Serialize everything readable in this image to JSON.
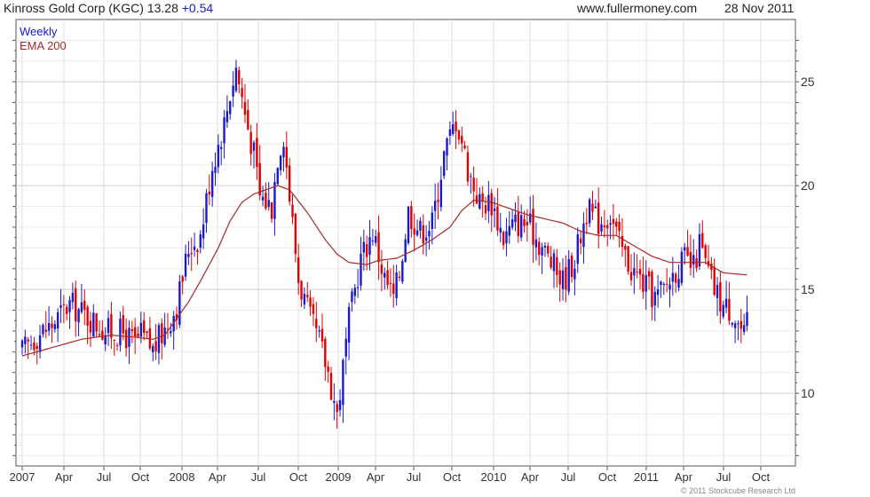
{
  "header": {
    "ticker_text": "Kinross Gold Corp (KGC) 13.28",
    "change": "+0.54",
    "website": "www.fullermoney.com",
    "date": "28 Nov 2011"
  },
  "legend": {
    "period": "Weekly",
    "indicator": "EMA 200"
  },
  "copyright": "© 2011 Stockcube Research Ltd",
  "colors": {
    "up": "#1a1acd",
    "down": "#e00000",
    "ema": "#a52a2a",
    "grid": "#dcdcdc",
    "axis": "#555555"
  },
  "chart_data": {
    "type": "candlestick",
    "title": "Kinross Gold Corp (KGC) 13.28 +0.54",
    "period": "Weekly",
    "indicator": "EMA 200",
    "x_ticks": [
      "2007",
      "Apr",
      "Jul",
      "Oct",
      "2008",
      "Apr",
      "Jul",
      "Oct",
      "2009",
      "Apr",
      "Jul",
      "Oct",
      "2010",
      "Apr",
      "Jul",
      "Oct",
      "2011",
      "Apr",
      "Jul",
      "Oct"
    ],
    "y_ticks": [
      10,
      15,
      20,
      25
    ],
    "ylim": [
      6.5,
      28
    ],
    "x_range_weeks": [
      0,
      257
    ],
    "grid": true,
    "price_path": [
      [
        0,
        12.0
      ],
      [
        5,
        12.8
      ],
      [
        10,
        13.3
      ],
      [
        16,
        14.3
      ],
      [
        22,
        13.7
      ],
      [
        28,
        13.0
      ],
      [
        34,
        12.9
      ],
      [
        38,
        12.4
      ],
      [
        40,
        12.8
      ],
      [
        44,
        12.1
      ],
      [
        48,
        13.1
      ],
      [
        52,
        14.2
      ],
      [
        56,
        17.0
      ],
      [
        60,
        17.6
      ],
      [
        64,
        21.0
      ],
      [
        68,
        23.0
      ],
      [
        70,
        24.5
      ],
      [
        72,
        25.7
      ],
      [
        75,
        23.5
      ],
      [
        78,
        21.5
      ],
      [
        80,
        19.5
      ],
      [
        84,
        19.0
      ],
      [
        86,
        21.5
      ],
      [
        88,
        22.5
      ],
      [
        90,
        19.5
      ],
      [
        93,
        15.5
      ],
      [
        97,
        13.5
      ],
      [
        100,
        12.5
      ],
      [
        103,
        11.0
      ],
      [
        106,
        9.0
      ],
      [
        108,
        11.2
      ],
      [
        110,
        13.5
      ],
      [
        114,
        16.5
      ],
      [
        118,
        17.8
      ],
      [
        122,
        15.5
      ],
      [
        125,
        14.6
      ],
      [
        127,
        15.8
      ],
      [
        130,
        18.8
      ],
      [
        134,
        17.8
      ],
      [
        138,
        18.2
      ],
      [
        142,
        21.5
      ],
      [
        146,
        23.2
      ],
      [
        148,
        22.2
      ],
      [
        150,
        20.8
      ],
      [
        154,
        19.2
      ],
      [
        158,
        19.2
      ],
      [
        162,
        17.5
      ],
      [
        166,
        18.2
      ],
      [
        170,
        18.2
      ],
      [
        174,
        17.3
      ],
      [
        178,
        16.3
      ],
      [
        182,
        15.4
      ],
      [
        186,
        16.5
      ],
      [
        190,
        18.8
      ],
      [
        194,
        18.3
      ],
      [
        198,
        18.6
      ],
      [
        201,
        17.2
      ],
      [
        205,
        16.0
      ],
      [
        209,
        15.3
      ],
      [
        213,
        14.6
      ],
      [
        216,
        15.0
      ],
      [
        220,
        16.0
      ],
      [
        223,
        16.4
      ],
      [
        226,
        16.0
      ],
      [
        228,
        17.2
      ],
      [
        230,
        16.2
      ],
      [
        233,
        15.0
      ],
      [
        236,
        14.2
      ],
      [
        239,
        14.0
      ],
      [
        241,
        13.4
      ],
      [
        243,
        12.7
      ],
      [
        244,
        13.3
      ]
    ],
    "ema_path": [
      [
        0,
        11.8
      ],
      [
        10,
        12.2
      ],
      [
        20,
        12.6
      ],
      [
        30,
        12.8
      ],
      [
        38,
        12.7
      ],
      [
        44,
        12.6
      ],
      [
        48,
        12.8
      ],
      [
        52,
        13.6
      ],
      [
        56,
        14.4
      ],
      [
        60,
        15.4
      ],
      [
        66,
        17.0
      ],
      [
        70,
        18.3
      ],
      [
        74,
        19.2
      ],
      [
        78,
        19.6
      ],
      [
        82,
        19.8
      ],
      [
        86,
        20.0
      ],
      [
        90,
        19.8
      ],
      [
        96,
        18.7
      ],
      [
        102,
        17.4
      ],
      [
        106,
        16.7
      ],
      [
        110,
        16.3
      ],
      [
        116,
        16.2
      ],
      [
        120,
        16.4
      ],
      [
        126,
        16.5
      ],
      [
        132,
        16.9
      ],
      [
        138,
        17.4
      ],
      [
        144,
        18.0
      ],
      [
        148,
        18.8
      ],
      [
        152,
        19.3
      ],
      [
        158,
        19.2
      ],
      [
        164,
        18.9
      ],
      [
        170,
        18.6
      ],
      [
        176,
        18.4
      ],
      [
        182,
        18.2
      ],
      [
        188,
        17.8
      ],
      [
        194,
        17.6
      ],
      [
        200,
        17.6
      ],
      [
        206,
        17.1
      ],
      [
        212,
        16.6
      ],
      [
        218,
        16.3
      ],
      [
        224,
        16.3
      ],
      [
        230,
        16.3
      ],
      [
        236,
        15.8
      ],
      [
        244,
        15.7
      ]
    ],
    "series": [
      {
        "name": "Weekly",
        "kind": "candles"
      },
      {
        "name": "EMA 200",
        "kind": "line"
      }
    ]
  }
}
